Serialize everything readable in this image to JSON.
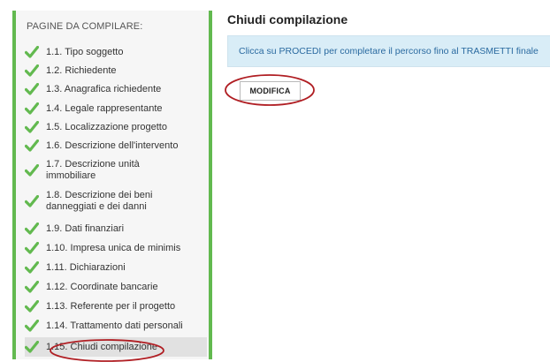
{
  "sidebar": {
    "title": "PAGINE DA COMPILARE:",
    "items": [
      {
        "label": "1.1. Tipo soggetto"
      },
      {
        "label": "1.2. Richiedente"
      },
      {
        "label": "1.3. Anagrafica richiedente"
      },
      {
        "label": "1.4. Legale rappresentante"
      },
      {
        "label": "1.5. Localizzazione progetto"
      },
      {
        "label": "1.6. Descrizione dell'intervento"
      },
      {
        "label": "1.7. Descrizione unità immobiliare"
      },
      {
        "label": "1.8. Descrizione dei beni danneggiati e dei danni"
      },
      {
        "label": "1.9. Dati finanziari"
      },
      {
        "label": "1.10. Impresa unica de minimis"
      },
      {
        "label": "1.11. Dichiarazioni"
      },
      {
        "label": "1.12. Coordinate bancarie"
      },
      {
        "label": "1.13. Referente per il progetto"
      },
      {
        "label": "1.14. Trattamento dati personali"
      },
      {
        "label": "1.15. Chiudi compilazione"
      }
    ]
  },
  "main": {
    "title": "Chiudi compilazione",
    "info": "Clicca su PROCEDI per completare il percorso fino al TRASMETTI finale",
    "modify_button": "MODIFICA"
  },
  "colors": {
    "check": "#62b94f",
    "sidebar_border": "#62b94f",
    "info_bg": "#d9edf7",
    "info_text": "#2a6aa0",
    "annotation_circle": "#b01e23"
  },
  "icons": {
    "check": "check-icon"
  }
}
